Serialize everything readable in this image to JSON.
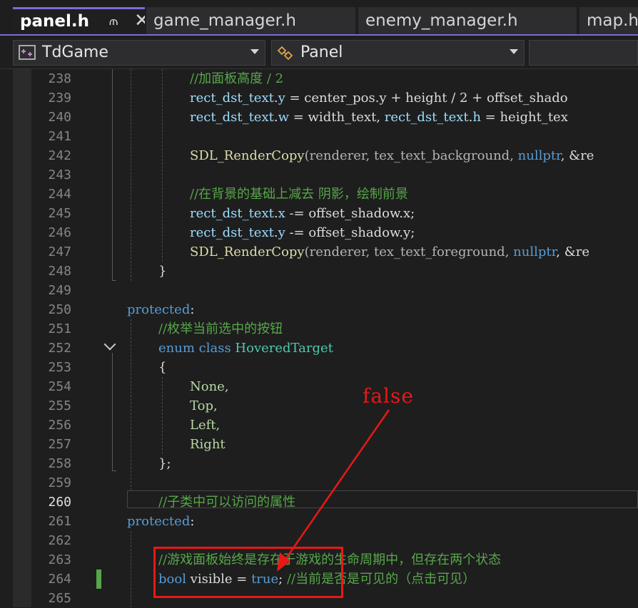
{
  "tabs": [
    {
      "label": "panel.h",
      "active": true
    },
    {
      "label": "game_manager.h",
      "active": false
    },
    {
      "label": "enemy_manager.h",
      "active": false
    },
    {
      "label": "map.h",
      "active": false
    }
  ],
  "navbar": {
    "project": "TdGame",
    "scope": "Panel"
  },
  "line_numbers": [
    "238",
    "239",
    "240",
    "241",
    "242",
    "243",
    "244",
    "245",
    "246",
    "247",
    "248",
    "249",
    "250",
    "251",
    "252",
    "253",
    "254",
    "255",
    "256",
    "257",
    "258",
    "259",
    "260",
    "261",
    "262",
    "263",
    "264",
    "265"
  ],
  "current_line": "260",
  "code": {
    "l238": "//加面板高度 / 2",
    "l239_a": "rect_dst_text",
    "l239_b": ".",
    "l239_c": "y",
    "l239_d": " = ",
    "l239_e": "center_pos",
    "l239_f": ".y + height / 2 + offset_shado",
    "l240_a": "rect_dst_text",
    "l240_b": ".",
    "l240_c": "w",
    "l240_d": " = width_text, ",
    "l240_e": "rect_dst_text",
    "l240_f": ".",
    "l240_g": "h",
    "l240_h": " = height_tex",
    "l242_fn": "SDL_RenderCopy",
    "l242_args": "(renderer, tex_text_background, ",
    "l242_null": "nullptr",
    "l242_tail": ", &re",
    "l244": "//在背景的基础上减去 阴影，绘制前景",
    "l245_a": "rect_dst_text",
    "l245_b": ".",
    "l245_c": "x",
    "l245_d": " -= offset_shadow.x;",
    "l246_a": "rect_dst_text",
    "l246_b": ".",
    "l246_c": "y",
    "l246_d": " -= offset_shadow.y;",
    "l247_fn": "SDL_RenderCopy",
    "l247_args": "(renderer, tex_text_foreground, ",
    "l247_null": "nullptr",
    "l247_tail": ", &re",
    "l248": "}",
    "l250": "protected",
    "l250_colon": ":",
    "l251": "//枚举当前选中的按钮",
    "l252_kw1": "enum",
    "l252_kw2": "class",
    "l252_type": "HoveredTarget",
    "l253": "{",
    "l254": "None,",
    "l255": "Top,",
    "l256": "Left,",
    "l257": "Right",
    "l258": "};",
    "l260": "//子类中可以访问的属性",
    "l261": "protected",
    "l261_colon": ":",
    "l263": "//游戏面板始终是存在于游戏的生命周期中，但存在两个状态",
    "l264_kw": "bool",
    "l264_var": " visible = ",
    "l264_val": "true",
    "l264_semi": ";",
    "l264_cmt": " //当前是否是可见的（点击可见）"
  },
  "annotation": {
    "text": "false",
    "color": "#e81818"
  },
  "colors": {
    "background": "#1e1e1e",
    "keyword": "#569cd6",
    "comment": "#57a64a",
    "function": "#dcdcaa",
    "type": "#4ec9b0",
    "accent": "#7b6cd8"
  }
}
